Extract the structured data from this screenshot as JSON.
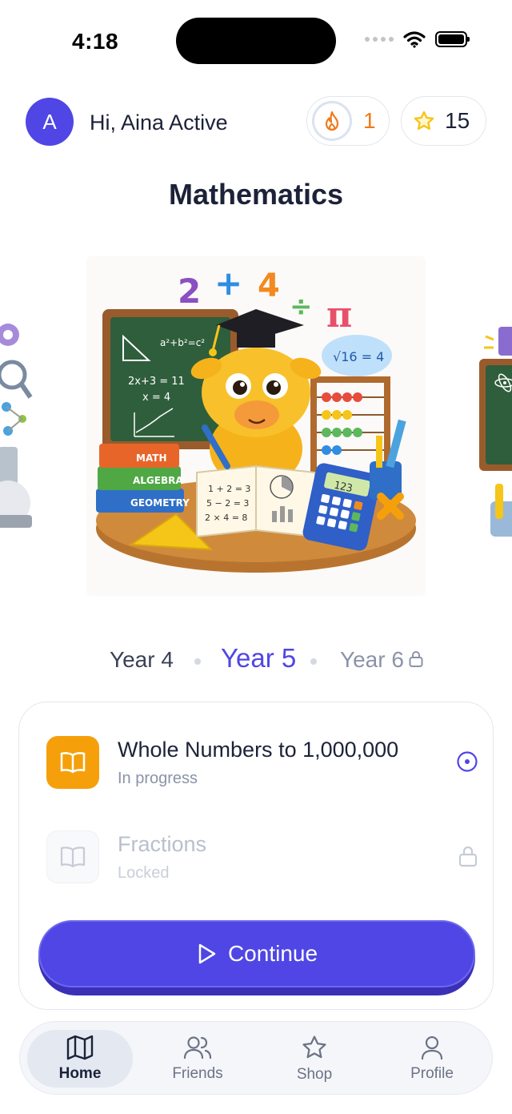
{
  "status_bar": {
    "time": "4:18"
  },
  "header": {
    "avatar_letter": "A",
    "greeting": "Hi, Aina Active",
    "streak_count": "1",
    "stars_count": "15"
  },
  "subject": {
    "title": "Mathematics",
    "illustration_labels": {
      "top_expression": "2 + 4",
      "pi": "π",
      "bubble": "√16 = 4",
      "board_formula": "a²+b²=c²",
      "board_eq1": "2x+3 = 11",
      "board_eq2": "x = 4",
      "book1": "MATH",
      "book2": "ALGEBRA",
      "book3": "GEOMETRY",
      "notebook1": "1 + 2 = 3",
      "notebook2": "5 − 2 = 3",
      "notebook3": "2 × 4 = 8",
      "calculator": "123"
    }
  },
  "years": {
    "items": [
      "Year 4",
      "Year 5",
      "Year 6"
    ],
    "selected": "Year 5",
    "locked": [
      "Year 6"
    ]
  },
  "lessons": [
    {
      "title": "Whole Numbers to 1,000,000",
      "status": "In progress"
    },
    {
      "title": "Fractions",
      "status": "Locked"
    }
  ],
  "continue_label": "Continue",
  "nav": {
    "items": [
      {
        "label": "Home",
        "icon": "map-icon"
      },
      {
        "label": "Friends",
        "icon": "users-icon"
      },
      {
        "label": "Shop",
        "icon": "star-icon"
      },
      {
        "label": "Profile",
        "icon": "user-icon"
      }
    ],
    "active": "Home"
  },
  "colors": {
    "accent": "#4f46e5",
    "streak": "#f07a1a",
    "lesson_active": "#f5a00b",
    "star": "#f5c518"
  }
}
